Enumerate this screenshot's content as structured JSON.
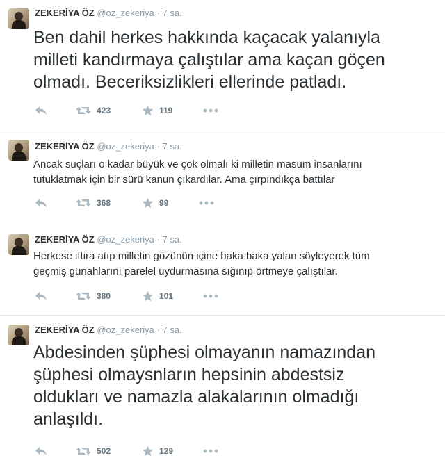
{
  "tweets": [
    {
      "name": "ZEKERİYA ÖZ",
      "handle": "@oz_zekeriya",
      "dot": "·",
      "time": "7 sa.",
      "text_lines": [
        "Ben dahil herkes hakkında kaçacak yalanıyla",
        "milleti kandırmaya çalıştılar ama kaçan göçen",
        "olmadı. Beceriksizlikleri ellerinde patladı."
      ],
      "retweets": "423",
      "favorites": "119",
      "icons": {
        "reply": "reply-icon",
        "retweet": "retweet-icon",
        "favorite": "star-icon",
        "more": "more-icon"
      }
    },
    {
      "name": "ZEKERİYA ÖZ",
      "handle": "@oz_zekeriya",
      "dot": "·",
      "time": "7 sa.",
      "text_lines": [
        "Ancak suçları o kadar büyük ve çok olmalı ki milletin masum insanlarını",
        "tutuklatmak için bir sürü kanun çıkardılar. Ama çırpındıkça battılar"
      ],
      "retweets": "368",
      "favorites": "99"
    },
    {
      "name": "ZEKERİYA ÖZ",
      "handle": "@oz_zekeriya",
      "dot": "·",
      "time": "7 sa.",
      "text_lines": [
        "Herkese iftira atıp milletin gözünün içine baka baka yalan söyleyerek tüm",
        "geçmiş günahlarını parelel uydurmasına sığınıp örtmeye çalıştılar."
      ],
      "retweets": "380",
      "favorites": "101"
    },
    {
      "name": "ZEKERİYA ÖZ",
      "handle": "@oz_zekeriya",
      "dot": "·",
      "time": "7 sa.",
      "text_lines": [
        "Abdesinden şüphesi olmayanın namazından",
        "şüphesi olmaysnların hepsinin abdestsiz",
        "oldukları ve namazla alakalarının olmadığı",
        "anlaşıldı."
      ],
      "retweets": "502",
      "favorites": "129"
    }
  ],
  "colors": {
    "icon": "#aab8c2",
    "count": "#66757f",
    "meta": "#8899a6",
    "text": "#292f33",
    "divider": "#e1e8ed"
  }
}
